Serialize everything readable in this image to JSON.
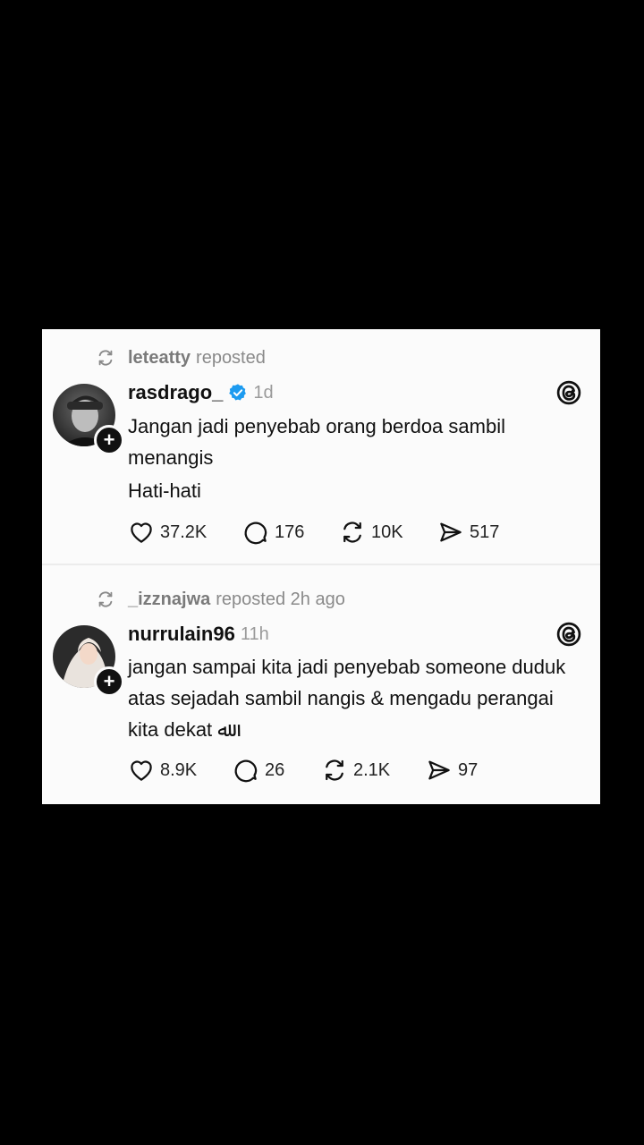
{
  "posts": [
    {
      "repost_user": "leteatty",
      "repost_text": "reposted",
      "username": "rasdrago_",
      "verified": true,
      "time": "1d",
      "text_lines": [
        "Jangan jadi penyebab orang berdoa sambil menangis",
        "Hati-hati"
      ],
      "likes": "37.2K",
      "replies": "176",
      "reposts": "10K",
      "shares": "517"
    },
    {
      "repost_user": "_izznajwa",
      "repost_text": "reposted 2h ago",
      "username": "nurrulain96",
      "verified": false,
      "time": "11h",
      "text_lines": [
        "jangan sampai kita jadi penyebab someone duduk atas sejadah sambil nangis & mengadu perangai kita dekat ﷲ"
      ],
      "likes": "8.9K",
      "replies": "26",
      "reposts": "2.1K",
      "shares": "97"
    }
  ],
  "colors": {
    "background": "#000000",
    "card": "#fbfbfb",
    "text": "#111111",
    "muted": "#8a8a8a",
    "verified": "#1d9bf0"
  },
  "icons": [
    "repost-icon",
    "verified-badge-icon",
    "threads-logo-icon",
    "heart-icon",
    "comment-icon",
    "repost-icon",
    "share-icon",
    "follow-plus-icon"
  ]
}
